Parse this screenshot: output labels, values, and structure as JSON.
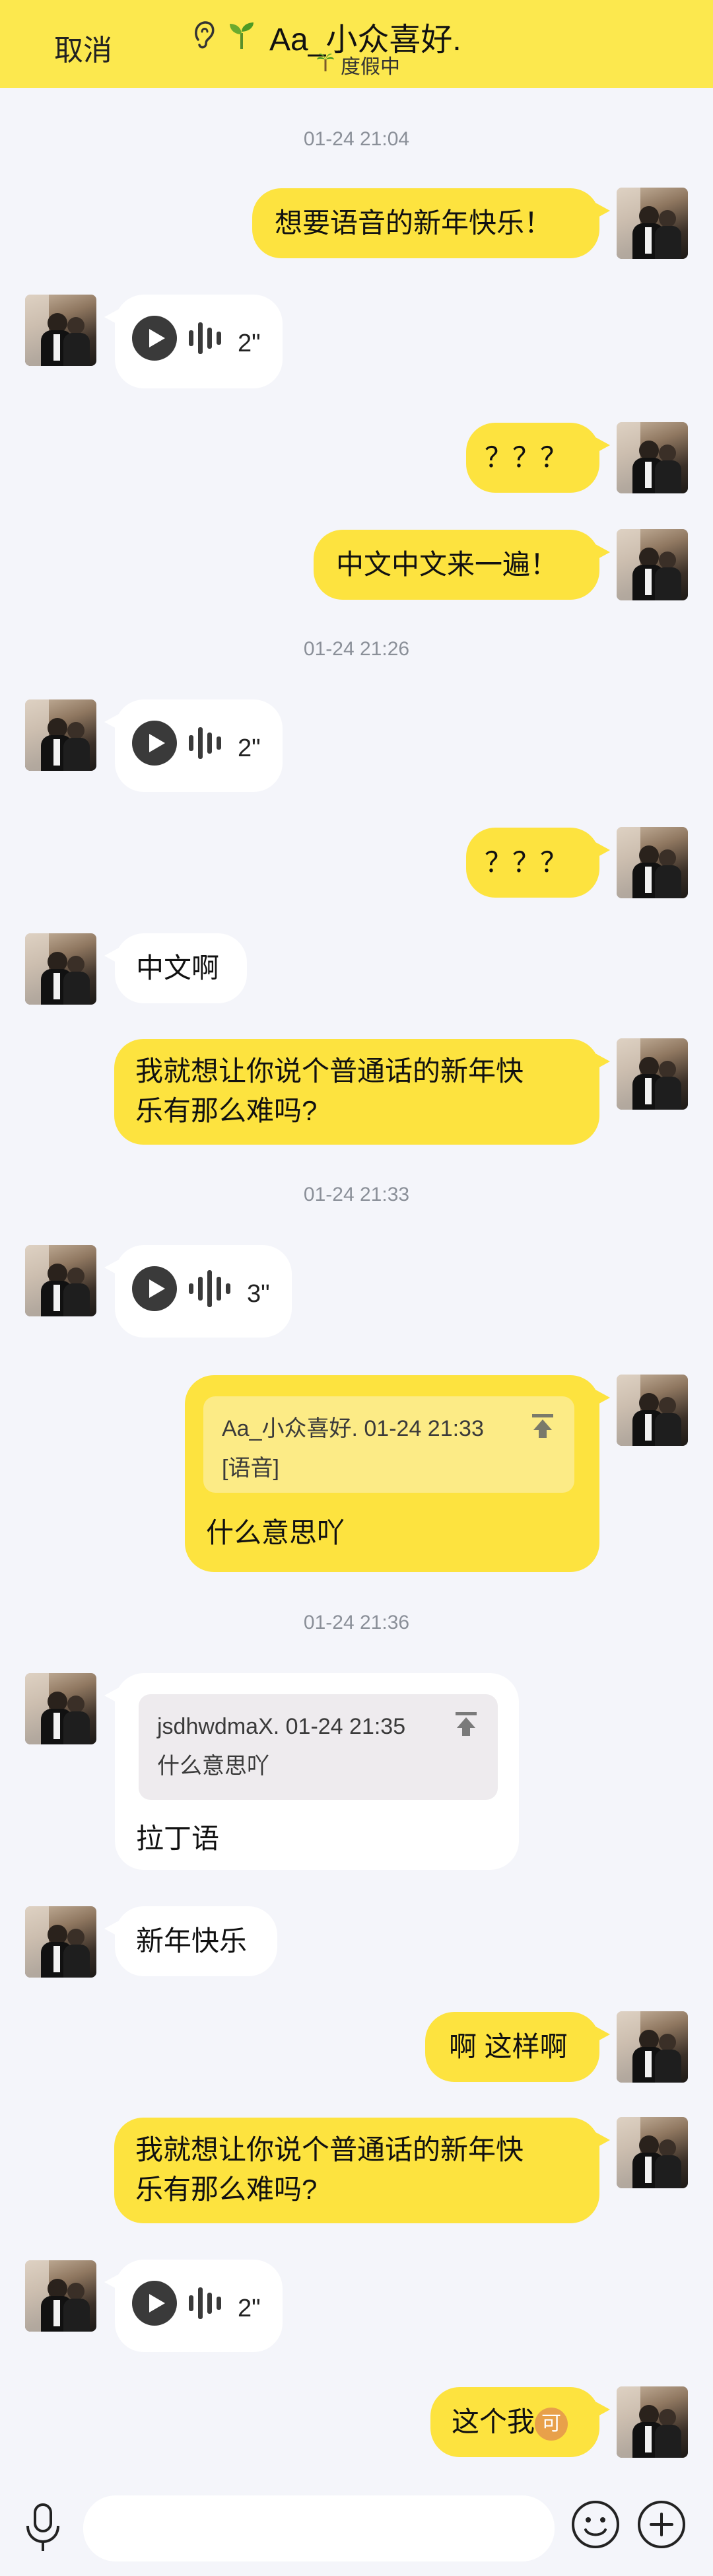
{
  "header": {
    "cancel_label": "取消",
    "title": "Aa_小众喜好.",
    "status": "度假中",
    "icons": [
      "ear-icon",
      "sprout-icon"
    ]
  },
  "timestamps": [
    "01-24 21:04",
    "01-24 21:26",
    "01-24 21:33",
    "01-24 21:36"
  ],
  "messages": {
    "m1": "想要语音的新年快乐！",
    "v1": "2\"",
    "m3": "？？？",
    "m4": "中文中文来一遍！",
    "v2": "2\"",
    "m6": "？？？",
    "m7": "中文啊",
    "m8_line1": "我就想让你说个普通话的新年快",
    "m8_line2": "乐有那么难吗?",
    "v3": "3\"",
    "q1_head": "Aa_小众喜好. 01-24 21:33",
    "q1_body": "[语音]",
    "m10": "什么意思吖",
    "q2_head": "jsdhwdmaX. 01-24 21:35",
    "q2_body": "什么意思吖",
    "m11": "拉丁语",
    "m12": "新年快乐",
    "m13": "啊 这样啊",
    "m14_line1": "我就想让你说个普通话的新年快",
    "m14_line2": "乐有那么难吗?",
    "v4": "2\"",
    "m16": "这个我",
    "m16_emoji": "可"
  },
  "colors": {
    "accent": "#FDE33F",
    "header_bg": "#FCE84E",
    "page_bg": "#F4F5FA",
    "timestamp": "#8A8F98"
  }
}
